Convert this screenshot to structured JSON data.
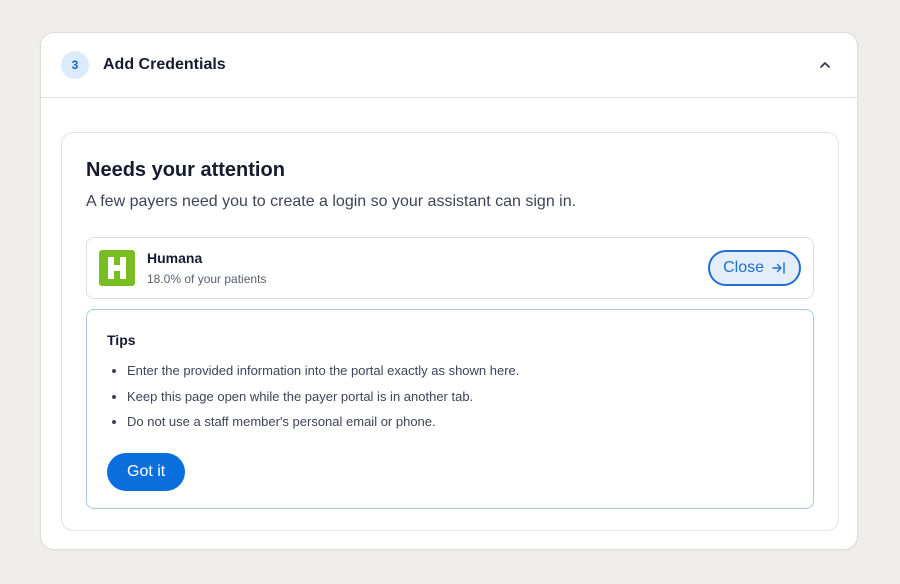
{
  "step": {
    "number": "3",
    "title": "Add Credentials",
    "icon": "chevron-up-icon"
  },
  "attention": {
    "title": "Needs your attention",
    "subtitle": "A few payers need you to create a login so your assistant can sign in."
  },
  "payer": {
    "logo_letter": "H",
    "logo_color": "#78be20",
    "name": "Humana",
    "share": "18.0% of your patients",
    "close_label": "Close",
    "close_icon": "arrow-right-to-line-icon"
  },
  "tips": {
    "title": "Tips",
    "items": [
      "Enter the provided information into the portal exactly as shown here.",
      "Keep this page open while the payer portal is in another tab.",
      "Do not use a staff member's personal email or phone."
    ],
    "button_label": "Got it"
  },
  "colors": {
    "accent": "#0a6fdc",
    "badge_bg": "#dcebfb",
    "tips_border": "#a9c9ec"
  }
}
